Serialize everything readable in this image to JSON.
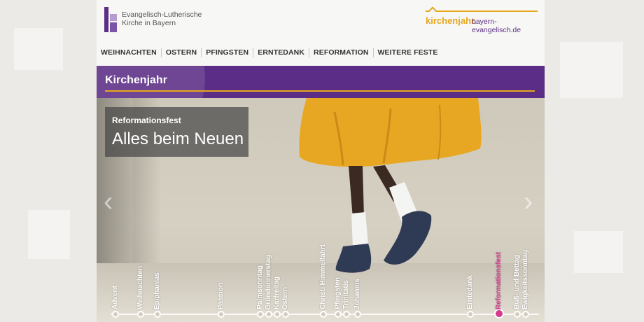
{
  "header": {
    "org_line1": "Evangelisch-Lutherische",
    "org_line2": "Kirche in Bayern",
    "kirchenjahr": "kirchenjahr.",
    "site": "bayern-evangelisch.de"
  },
  "nav": [
    "WEIHNACHTEN",
    "OSTERN",
    "PFINGSTEN",
    "ERNTEDANK",
    "REFORMATION",
    "WEITERE FESTE"
  ],
  "section_title": "Kirchenjahr",
  "hero": {
    "subtitle": "Reformationsfest",
    "title": "Alles beim Neuen",
    "prev_arrow": "‹",
    "next_arrow": "›"
  },
  "timeline": [
    {
      "label": "Advent"
    },
    {
      "label": "Weihnachten"
    },
    {
      "label": "Epiphanias"
    },
    {
      "label": "Passion"
    },
    {
      "label": "Palmsonntag"
    },
    {
      "label": "Gründonnerstag"
    },
    {
      "label": "Karfreitag"
    },
    {
      "label": "Ostern"
    },
    {
      "label": "Christi Himmelfahrt"
    },
    {
      "label": "Pfingsten"
    },
    {
      "label": "Trinitatis"
    },
    {
      "label": "Johannis"
    },
    {
      "label": "Erntedank"
    },
    {
      "label": "Reformationsfest",
      "active": true
    },
    {
      "label": "Buß- und Bettag"
    },
    {
      "label": "Ewigkeitssonntag"
    }
  ],
  "colors": {
    "purple": "#5b2d86",
    "gold": "#e6a81d",
    "active": "#d63a8c"
  }
}
